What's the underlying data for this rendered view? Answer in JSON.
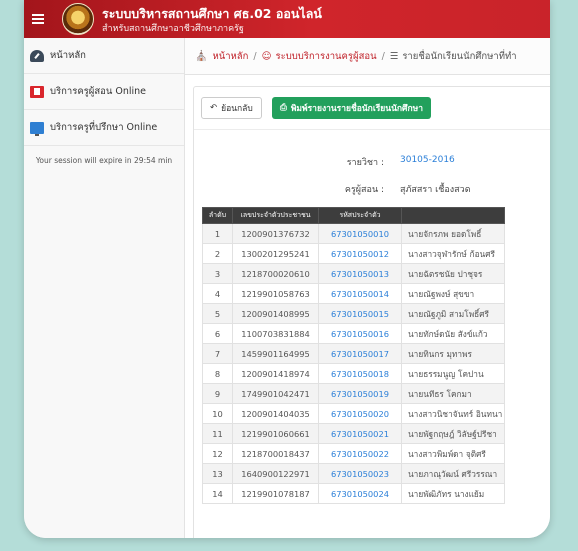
{
  "header": {
    "title": "ระบบบริหารสถานศึกษา ศธ.02 ออนไลน์",
    "subtitle": "สำหรับสถานศึกษาอาชีวศึกษาภาครัฐ"
  },
  "sidebar": {
    "items": [
      {
        "label": "หน้าหลัก",
        "icon": "dashboard-icon"
      },
      {
        "label": "บริการครูผู้สอน Online",
        "icon": "teacher-icon"
      },
      {
        "label": "บริการครูที่ปรึกษา Online",
        "icon": "monitor-icon"
      }
    ],
    "session": "Your session will expire in 29:54 min"
  },
  "breadcrumb": {
    "home": "หน้าหลัก",
    "service": "ระบบบริการงานครูผู้สอน",
    "current": "รายชื่อนักเรียนนักศึกษาที่ทำ"
  },
  "toolbar": {
    "back_label": "ย้อนกลับ",
    "print_label": "พิมพ์รายงานรายชื่อนักเรียนนักศึกษา"
  },
  "course": {
    "subject_label": "รายวิชา :",
    "subject_value": "30105-2016",
    "teacher_label": "ครูผู้สอน :",
    "teacher_value": "สุภัสสรา เชื้องสวด"
  },
  "table": {
    "headers": [
      "ลำดับ",
      "เลขประจำตัวประชาชน",
      "รหัสประจำตัว",
      ""
    ],
    "rows": [
      [
        "1",
        "1200901376732",
        "67301050010",
        "นายจักรภพ ยอดโพธิ์"
      ],
      [
        "2",
        "1300201295241",
        "67301050012",
        "นางสาวจุฬารักษ์ ก้อนศรี"
      ],
      [
        "3",
        "1218700020610",
        "67301050013",
        "นายฉัตรชนัย ปาชุจร"
      ],
      [
        "4",
        "1219901058763",
        "67301050014",
        "นายณัฐพงษ์ สุขขา"
      ],
      [
        "5",
        "1200901408995",
        "67301050015",
        "นายณัฐภูมิ สามโพธิ์ศรี"
      ],
      [
        "6",
        "1100703831884",
        "67301050016",
        "นายทักษ์ดนัย สังข์แก้ว"
      ],
      [
        "7",
        "1459901164995",
        "67301050017",
        "นายทินกร มุทาพร"
      ],
      [
        "8",
        "1200901418974",
        "67301050018",
        "นายธรรมนูญ โคปาน"
      ],
      [
        "9",
        "1749901042471",
        "67301050019",
        "นายนทีธร โคกมา"
      ],
      [
        "10",
        "1200901404035",
        "67301050020",
        "นางสาวนิชาจันทร์ อินทนา"
      ],
      [
        "11",
        "1219901060661",
        "67301050021",
        "นายพัฐกฤษฎ์ วิลัษฐ์ปรีชา"
      ],
      [
        "12",
        "1218700018437",
        "67301050022",
        "นางสาวพิมพ์ดา จุติศรี"
      ],
      [
        "13",
        "1640900122971",
        "67301050023",
        "นายภาณุวัฒน์ ศรีวรรณา"
      ],
      [
        "14",
        "1219901078187",
        "67301050024",
        "นายพัฒิภัทร นางแย้ม"
      ]
    ]
  },
  "colors": {
    "header_red": "#c9232a",
    "link_blue": "#2b7fd8",
    "print_green": "#22a05c",
    "table_head": "#3d3d3d"
  }
}
